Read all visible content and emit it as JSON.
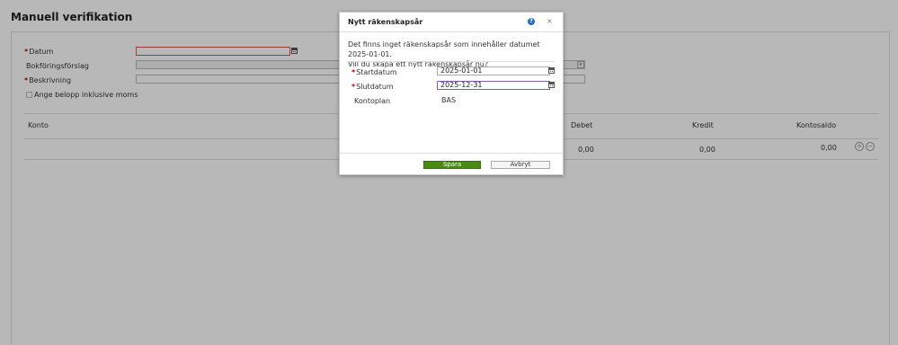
{
  "page": {
    "title": "Manuell verifikation"
  },
  "form": {
    "datum_label": "Datum",
    "bokforingsforslag_label": "Bokföringsförslag",
    "beskrivning_label": "Beskrivning",
    "inklusive_moms_label": "Ange belopp inklusive moms"
  },
  "table": {
    "headers": {
      "konto": "Konto",
      "debet": "Debet",
      "kredit": "Kredit",
      "kontosaldo": "Kontosaldo"
    },
    "row": {
      "debet": "0,00",
      "kredit": "0,00",
      "kontosaldo": "0,00"
    }
  },
  "dialog": {
    "title": "Nytt räkenskapsår",
    "message_line1": "Det finns inget räkenskapsår som innehåller datumet 2025-01-01.",
    "message_line2": "Vill du skapa ett nytt räkenskapsår nu?",
    "startdatum_label": "Startdatum",
    "startdatum_value": "2025-01-01",
    "slutdatum_label": "Slutdatum",
    "slutdatum_value": "2025-12-31",
    "kontoplan_label": "Kontoplan",
    "kontoplan_value": "BAS",
    "save_label": "Spara",
    "cancel_label": "Avbryt"
  },
  "colors": {
    "primary_button": "#4a8a11",
    "help_icon": "#1f6fd0",
    "required_marker": "#cc0000"
  },
  "icons": [
    "calendar-icon",
    "dropdown-icon",
    "help-icon",
    "close-icon",
    "add-row-icon",
    "remove-row-icon"
  ]
}
